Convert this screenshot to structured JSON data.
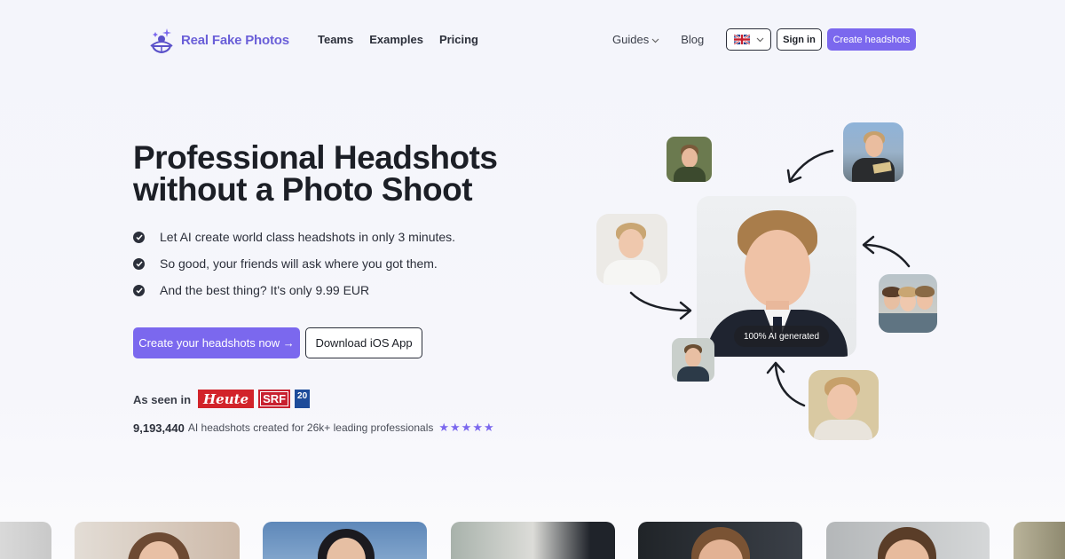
{
  "brand": {
    "name": "Real Fake Photos",
    "accent": "#7b68ee"
  },
  "nav": {
    "left": [
      "Teams",
      "Examples",
      "Pricing"
    ],
    "guides": "Guides",
    "blog": "Blog",
    "lang_icon": "uk-flag-icon",
    "sign_in": "Sign in",
    "cta": "Create headshots"
  },
  "hero": {
    "title_line1": "Professional Headshots",
    "title_line2": "without a Photo Shoot",
    "bullets": [
      "Let AI create world class headshots in only 3 minutes.",
      "So good, your friends will ask where you got them.",
      "And the best thing? It's only 9.99 EUR"
    ],
    "primary_button": "Create your headshots now →",
    "secondary_button": "Download iOS App",
    "seen_in": "As seen in",
    "press": {
      "heute": "Heute",
      "srf": "SRF",
      "twenty": "20"
    },
    "count": "9,193,440",
    "count_text": "AI headshots created for 26k+ leading professionals",
    "stars": "★★★★★"
  },
  "showcase": {
    "badge": "100% AI generated"
  }
}
